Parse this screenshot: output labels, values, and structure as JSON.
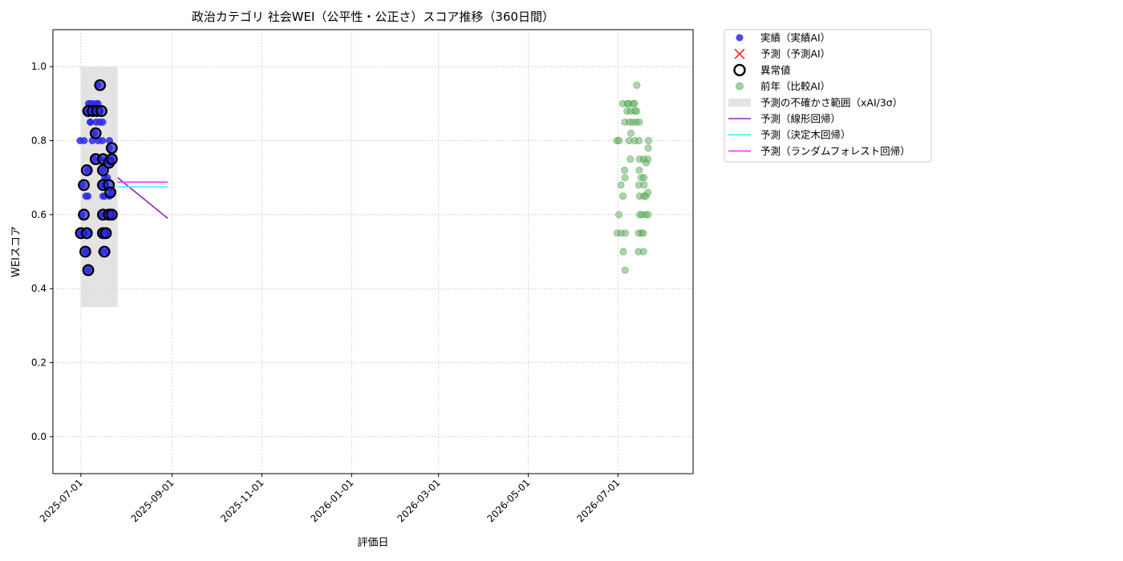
{
  "chart_data": {
    "type": "scatter",
    "title": "政治カテゴリ 社会WEI（公平性・公正さ）スコア推移（360日間）",
    "xlabel": "評価日",
    "ylabel": "WEIスコア",
    "xlim": [
      "2025-06-12",
      "2026-08-21"
    ],
    "ylim": [
      -0.1,
      1.1
    ],
    "x_ticks": [
      "2025-07-01",
      "2025-09-01",
      "2025-11-01",
      "2026-01-01",
      "2026-03-01",
      "2026-05-01",
      "2026-07-01"
    ],
    "y_ticks": [
      "0.0",
      "0.2",
      "0.4",
      "0.6",
      "0.8",
      "1.0"
    ],
    "grid": true,
    "legend_position": "outside-right-top",
    "colors": {
      "actual": "#2b2be6",
      "prediction_marker": "#ff3333",
      "anomaly": "#000000",
      "previous_year": "#6ab06a",
      "previous_year_dense": "#008000",
      "uncertainty_band": "#d9d9d9",
      "linear": "#8e2aa8",
      "tree": "#33ffff",
      "forest": "#ff33ff"
    },
    "legend": [
      {
        "key": "actual",
        "label": "実績（実績AI）"
      },
      {
        "key": "prediction",
        "label": "予測（予測AI）"
      },
      {
        "key": "anomaly",
        "label": "異常値"
      },
      {
        "key": "previous_year",
        "label": "前年（比較AI）"
      },
      {
        "key": "band",
        "label": "予測の不確かさ範囲（xAI/3σ）"
      },
      {
        "key": "linear",
        "label": "予測（線形回帰）"
      },
      {
        "key": "tree",
        "label": "予測（決定木回帰）"
      },
      {
        "key": "forest",
        "label": "予測（ランダムフォレスト回帰）"
      }
    ],
    "uncertainty_band": {
      "x": [
        "2025-07-01",
        "2025-07-26"
      ],
      "y": [
        0.35,
        1.0
      ]
    },
    "series": [
      {
        "key": "actual",
        "points": [
          [
            "2025-07-01",
            0.55
          ],
          [
            "2025-07-01",
            0.8
          ],
          [
            "2025-07-02",
            0.6
          ],
          [
            "2025-07-02",
            0.68
          ],
          [
            "2025-07-03",
            0.55
          ],
          [
            "2025-07-03",
            0.8
          ],
          [
            "2025-07-04",
            0.65
          ],
          [
            "2025-07-04",
            0.5
          ],
          [
            "2025-07-05",
            0.65
          ],
          [
            "2025-07-05",
            0.5
          ],
          [
            "2025-07-05",
            0.88
          ],
          [
            "2025-07-06",
            0.72
          ],
          [
            "2025-07-06",
            0.55
          ],
          [
            "2025-07-06",
            0.45
          ],
          [
            "2025-07-06",
            0.9
          ],
          [
            "2025-07-07",
            0.85
          ],
          [
            "2025-07-07",
            0.9
          ],
          [
            "2025-07-08",
            0.8
          ],
          [
            "2025-07-08",
            0.88
          ],
          [
            "2025-07-08",
            0.85
          ],
          [
            "2025-07-09",
            0.9
          ],
          [
            "2025-07-10",
            0.75
          ],
          [
            "2025-07-10",
            0.88
          ],
          [
            "2025-07-10",
            0.82
          ],
          [
            "2025-07-11",
            0.85
          ],
          [
            "2025-07-11",
            0.9
          ],
          [
            "2025-07-12",
            0.8
          ],
          [
            "2025-07-12",
            0.88
          ],
          [
            "2025-07-13",
            0.95
          ],
          [
            "2025-07-13",
            0.9
          ],
          [
            "2025-07-14",
            0.85
          ],
          [
            "2025-07-14",
            0.88
          ],
          [
            "2025-07-15",
            0.5
          ],
          [
            "2025-07-15",
            0.55
          ],
          [
            "2025-07-15",
            0.68
          ],
          [
            "2025-07-15",
            0.72
          ],
          [
            "2025-07-15",
            0.75
          ],
          [
            "2025-07-15",
            0.6
          ],
          [
            "2025-07-16",
            0.8
          ],
          [
            "2025-07-16",
            0.85
          ],
          [
            "2025-07-16",
            0.65
          ],
          [
            "2025-07-17",
            0.7
          ],
          [
            "2025-07-17",
            0.55
          ],
          [
            "2025-07-17",
            0.6
          ],
          [
            "2025-07-18",
            0.5
          ],
          [
            "2025-07-18",
            0.65
          ],
          [
            "2025-07-18",
            0.68
          ],
          [
            "2025-07-19",
            0.55
          ],
          [
            "2025-07-19",
            0.75
          ],
          [
            "2025-07-19",
            0.7
          ],
          [
            "2025-07-20",
            0.6
          ],
          [
            "2025-07-20",
            0.65
          ],
          [
            "2025-07-20",
            0.74
          ],
          [
            "2025-07-21",
            0.66
          ],
          [
            "2025-07-21",
            0.78
          ],
          [
            "2025-07-21",
            0.8
          ],
          [
            "2025-07-22",
            0.75
          ],
          [
            "2025-07-22",
            0.6
          ]
        ]
      },
      {
        "key": "anomaly",
        "points": [
          [
            "2025-07-01",
            0.55
          ],
          [
            "2025-07-03",
            0.6
          ],
          [
            "2025-07-03",
            0.68
          ],
          [
            "2025-07-04",
            0.5
          ],
          [
            "2025-07-05",
            0.72
          ],
          [
            "2025-07-05",
            0.55
          ],
          [
            "2025-07-06",
            0.45
          ],
          [
            "2025-07-06",
            0.88
          ],
          [
            "2025-07-09",
            0.88
          ],
          [
            "2025-07-11",
            0.75
          ],
          [
            "2025-07-11",
            0.82
          ],
          [
            "2025-07-12",
            0.88
          ],
          [
            "2025-07-14",
            0.95
          ],
          [
            "2025-07-15",
            0.88
          ],
          [
            "2025-07-16",
            0.75
          ],
          [
            "2025-07-16",
            0.72
          ],
          [
            "2025-07-16",
            0.68
          ],
          [
            "2025-07-16",
            0.6
          ],
          [
            "2025-07-16",
            0.55
          ],
          [
            "2025-07-17",
            0.5
          ],
          [
            "2025-07-18",
            0.55
          ],
          [
            "2025-07-20",
            0.74
          ],
          [
            "2025-07-20",
            0.68
          ],
          [
            "2025-07-20",
            0.6
          ],
          [
            "2025-07-21",
            0.66
          ],
          [
            "2025-07-22",
            0.78
          ],
          [
            "2025-07-22",
            0.75
          ],
          [
            "2025-07-22",
            0.6
          ]
        ]
      },
      {
        "key": "previous_year",
        "points": [
          [
            "2026-07-01",
            0.8
          ],
          [
            "2026-07-01",
            0.55
          ],
          [
            "2026-07-02",
            0.6
          ],
          [
            "2026-07-02",
            0.8
          ],
          [
            "2026-07-03",
            0.68
          ],
          [
            "2026-07-03",
            0.55
          ],
          [
            "2026-07-04",
            0.65
          ],
          [
            "2026-07-04",
            0.5
          ],
          [
            "2026-07-05",
            0.7
          ],
          [
            "2026-07-05",
            0.9
          ],
          [
            "2026-07-06",
            0.72
          ],
          [
            "2026-07-06",
            0.85
          ],
          [
            "2026-07-06",
            0.45
          ],
          [
            "2026-07-06",
            0.55
          ],
          [
            "2026-07-07",
            0.88
          ],
          [
            "2026-07-07",
            0.9
          ],
          [
            "2026-07-08",
            0.8
          ],
          [
            "2026-07-08",
            0.85
          ],
          [
            "2026-07-09",
            0.9
          ],
          [
            "2026-07-10",
            0.75
          ],
          [
            "2026-07-10",
            0.88
          ],
          [
            "2026-07-10",
            0.82
          ],
          [
            "2026-07-11",
            0.85
          ],
          [
            "2026-07-11",
            0.9
          ],
          [
            "2026-07-12",
            0.8
          ],
          [
            "2026-07-12",
            0.88
          ],
          [
            "2026-07-13",
            0.95
          ],
          [
            "2026-07-13",
            0.9
          ],
          [
            "2026-07-14",
            0.85
          ],
          [
            "2026-07-14",
            0.88
          ],
          [
            "2026-07-15",
            0.5
          ],
          [
            "2026-07-15",
            0.55
          ],
          [
            "2026-07-15",
            0.68
          ],
          [
            "2026-07-15",
            0.72
          ],
          [
            "2026-07-15",
            0.75
          ],
          [
            "2026-07-15",
            0.6
          ],
          [
            "2026-07-16",
            0.8
          ],
          [
            "2026-07-16",
            0.85
          ],
          [
            "2026-07-16",
            0.65
          ],
          [
            "2026-07-17",
            0.7
          ],
          [
            "2026-07-17",
            0.55
          ],
          [
            "2026-07-17",
            0.6
          ],
          [
            "2026-07-18",
            0.5
          ],
          [
            "2026-07-18",
            0.65
          ],
          [
            "2026-07-18",
            0.68
          ],
          [
            "2026-07-19",
            0.55
          ],
          [
            "2026-07-19",
            0.75
          ],
          [
            "2026-07-19",
            0.7
          ],
          [
            "2026-07-20",
            0.6
          ],
          [
            "2026-07-20",
            0.65
          ],
          [
            "2026-07-20",
            0.74
          ],
          [
            "2026-07-21",
            0.66
          ],
          [
            "2026-07-21",
            0.78
          ],
          [
            "2026-07-21",
            0.8
          ],
          [
            "2026-07-22",
            0.75
          ],
          [
            "2026-07-22",
            0.6
          ]
        ]
      }
    ],
    "prediction_lines": [
      {
        "key": "linear",
        "points": [
          [
            "2025-07-26",
            0.7
          ],
          [
            "2025-08-29",
            0.59
          ]
        ]
      },
      {
        "key": "tree",
        "points": [
          [
            "2025-07-26",
            0.675
          ],
          [
            "2025-08-29",
            0.675
          ]
        ]
      },
      {
        "key": "forest",
        "points": [
          [
            "2025-07-26",
            0.688
          ],
          [
            "2025-08-29",
            0.688
          ]
        ]
      }
    ]
  }
}
